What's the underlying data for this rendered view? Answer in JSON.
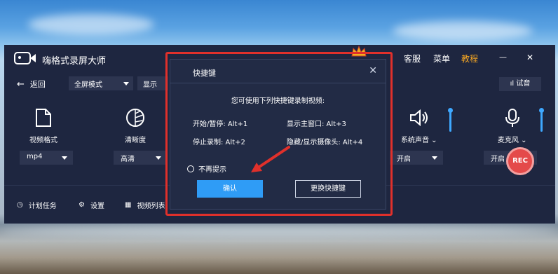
{
  "app": {
    "title": "嗨格式录屏大师"
  },
  "topnav": {
    "service": "客服",
    "menu": "菜单",
    "tutorial": "教程",
    "minimize": "—",
    "close": "✕"
  },
  "toolbar": {
    "back": "返回",
    "mode": "全屏模式",
    "screen": "显示器1",
    "test": "试音"
  },
  "options": [
    {
      "label": "视频格式",
      "value": "mp4"
    },
    {
      "label": "清晰度",
      "value": "高清"
    },
    {
      "label": "系统声音",
      "value": "开启"
    },
    {
      "label": "麦克风",
      "value": "开启"
    }
  ],
  "bottom": {
    "schedule": "计划任务",
    "settings": "设置",
    "videolist": "视频列表",
    "rec": "REC"
  },
  "dialog": {
    "title": "快捷键",
    "close": "✕",
    "desc": "您可使用下列快捷键录制视频:",
    "shortcuts": [
      "开始/暂停: Alt+1",
      "显示主窗口: Alt+3",
      "停止录制: Alt+2",
      "隐藏/显示摄像头: Alt+4"
    ],
    "noshow": "不再提示",
    "confirm": "确认",
    "change": "更换快捷键"
  },
  "colors": {
    "accent": "#2f9cf6",
    "highlight": "#e0302b",
    "window": "#1e2640",
    "tutorial": "#f5a623"
  }
}
